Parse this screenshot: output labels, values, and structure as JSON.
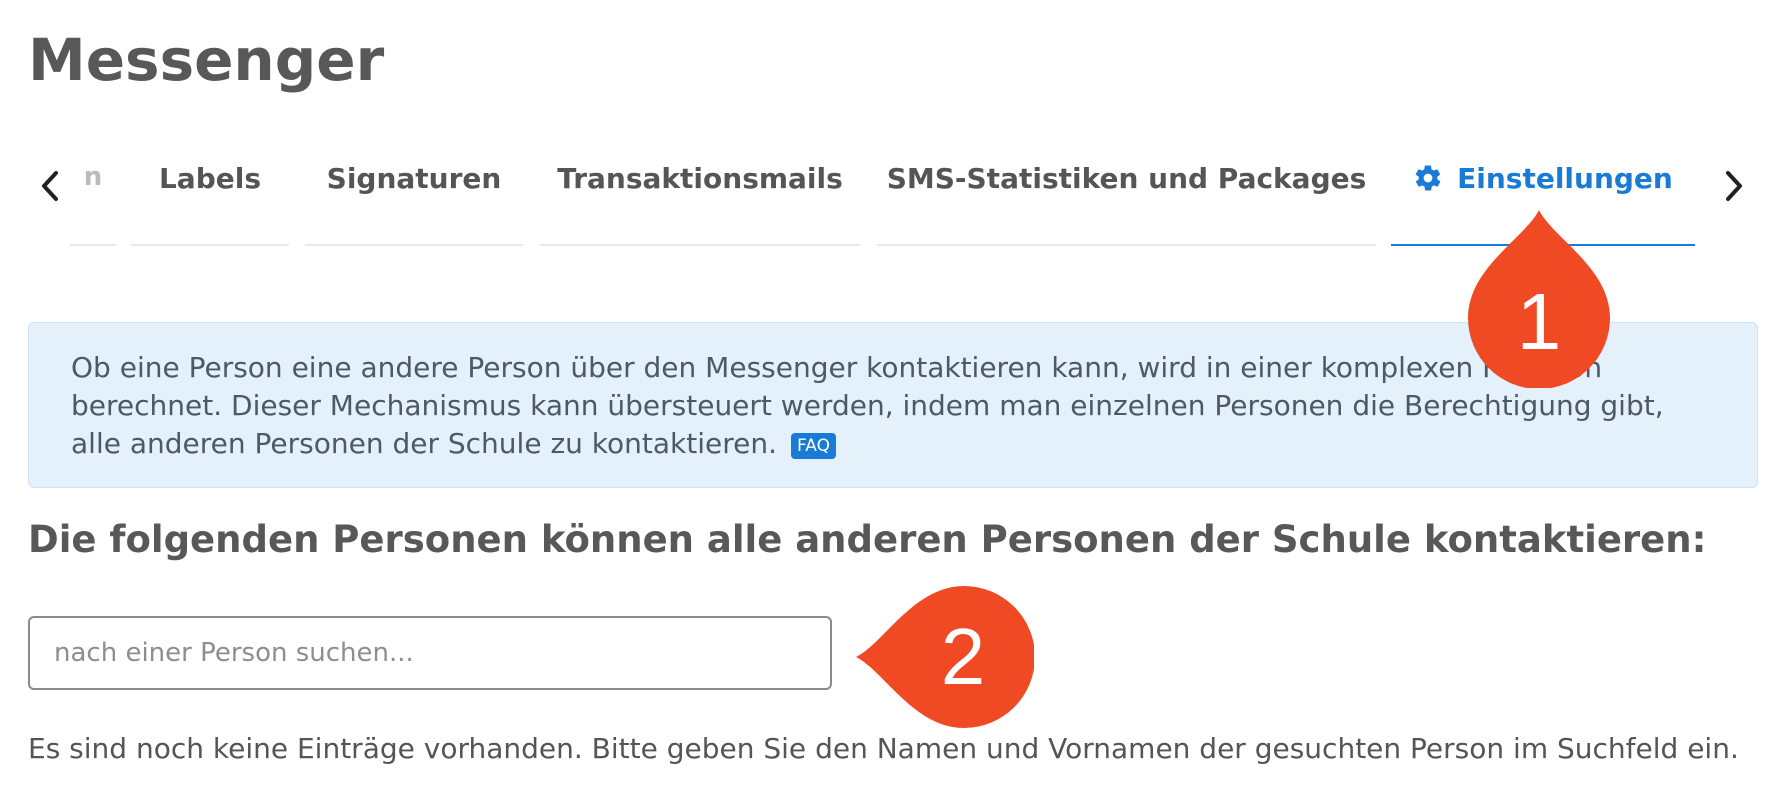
{
  "page": {
    "title": "Messenger"
  },
  "tabs": {
    "partial_label": "n",
    "items": [
      {
        "label": "Labels"
      },
      {
        "label": "Signaturen"
      },
      {
        "label": "Transaktionsmails"
      },
      {
        "label": "SMS-Statistiken und Packages"
      },
      {
        "label": "Einstellungen",
        "icon": "gear-icon",
        "active": true
      }
    ]
  },
  "info": {
    "text": "Ob eine Person eine andere Person über den Messenger kontaktieren kann, wird in einer komplexen Funktion berechnet. Dieser Mechanismus kann übersteuert werden, indem man einzelnen Personen die Berechtigung gibt, alle anderen Personen der Schule zu kontaktieren.",
    "faq_label": "FAQ"
  },
  "section": {
    "heading": "Die folgenden Personen können alle anderen Personen der Schule kontaktieren:"
  },
  "search": {
    "placeholder": "nach einer Person suchen..."
  },
  "empty_state": {
    "text": "Es sind noch keine Einträge vorhanden. Bitte geben Sie den Namen und Vornamen der gesuchten Person im Suchfeld ein."
  },
  "annotations": [
    {
      "number": "1"
    },
    {
      "number": "2"
    }
  ],
  "colors": {
    "accent": "#1a7bd6",
    "marker": "#f04a24",
    "info_bg": "#e4f1fb"
  }
}
